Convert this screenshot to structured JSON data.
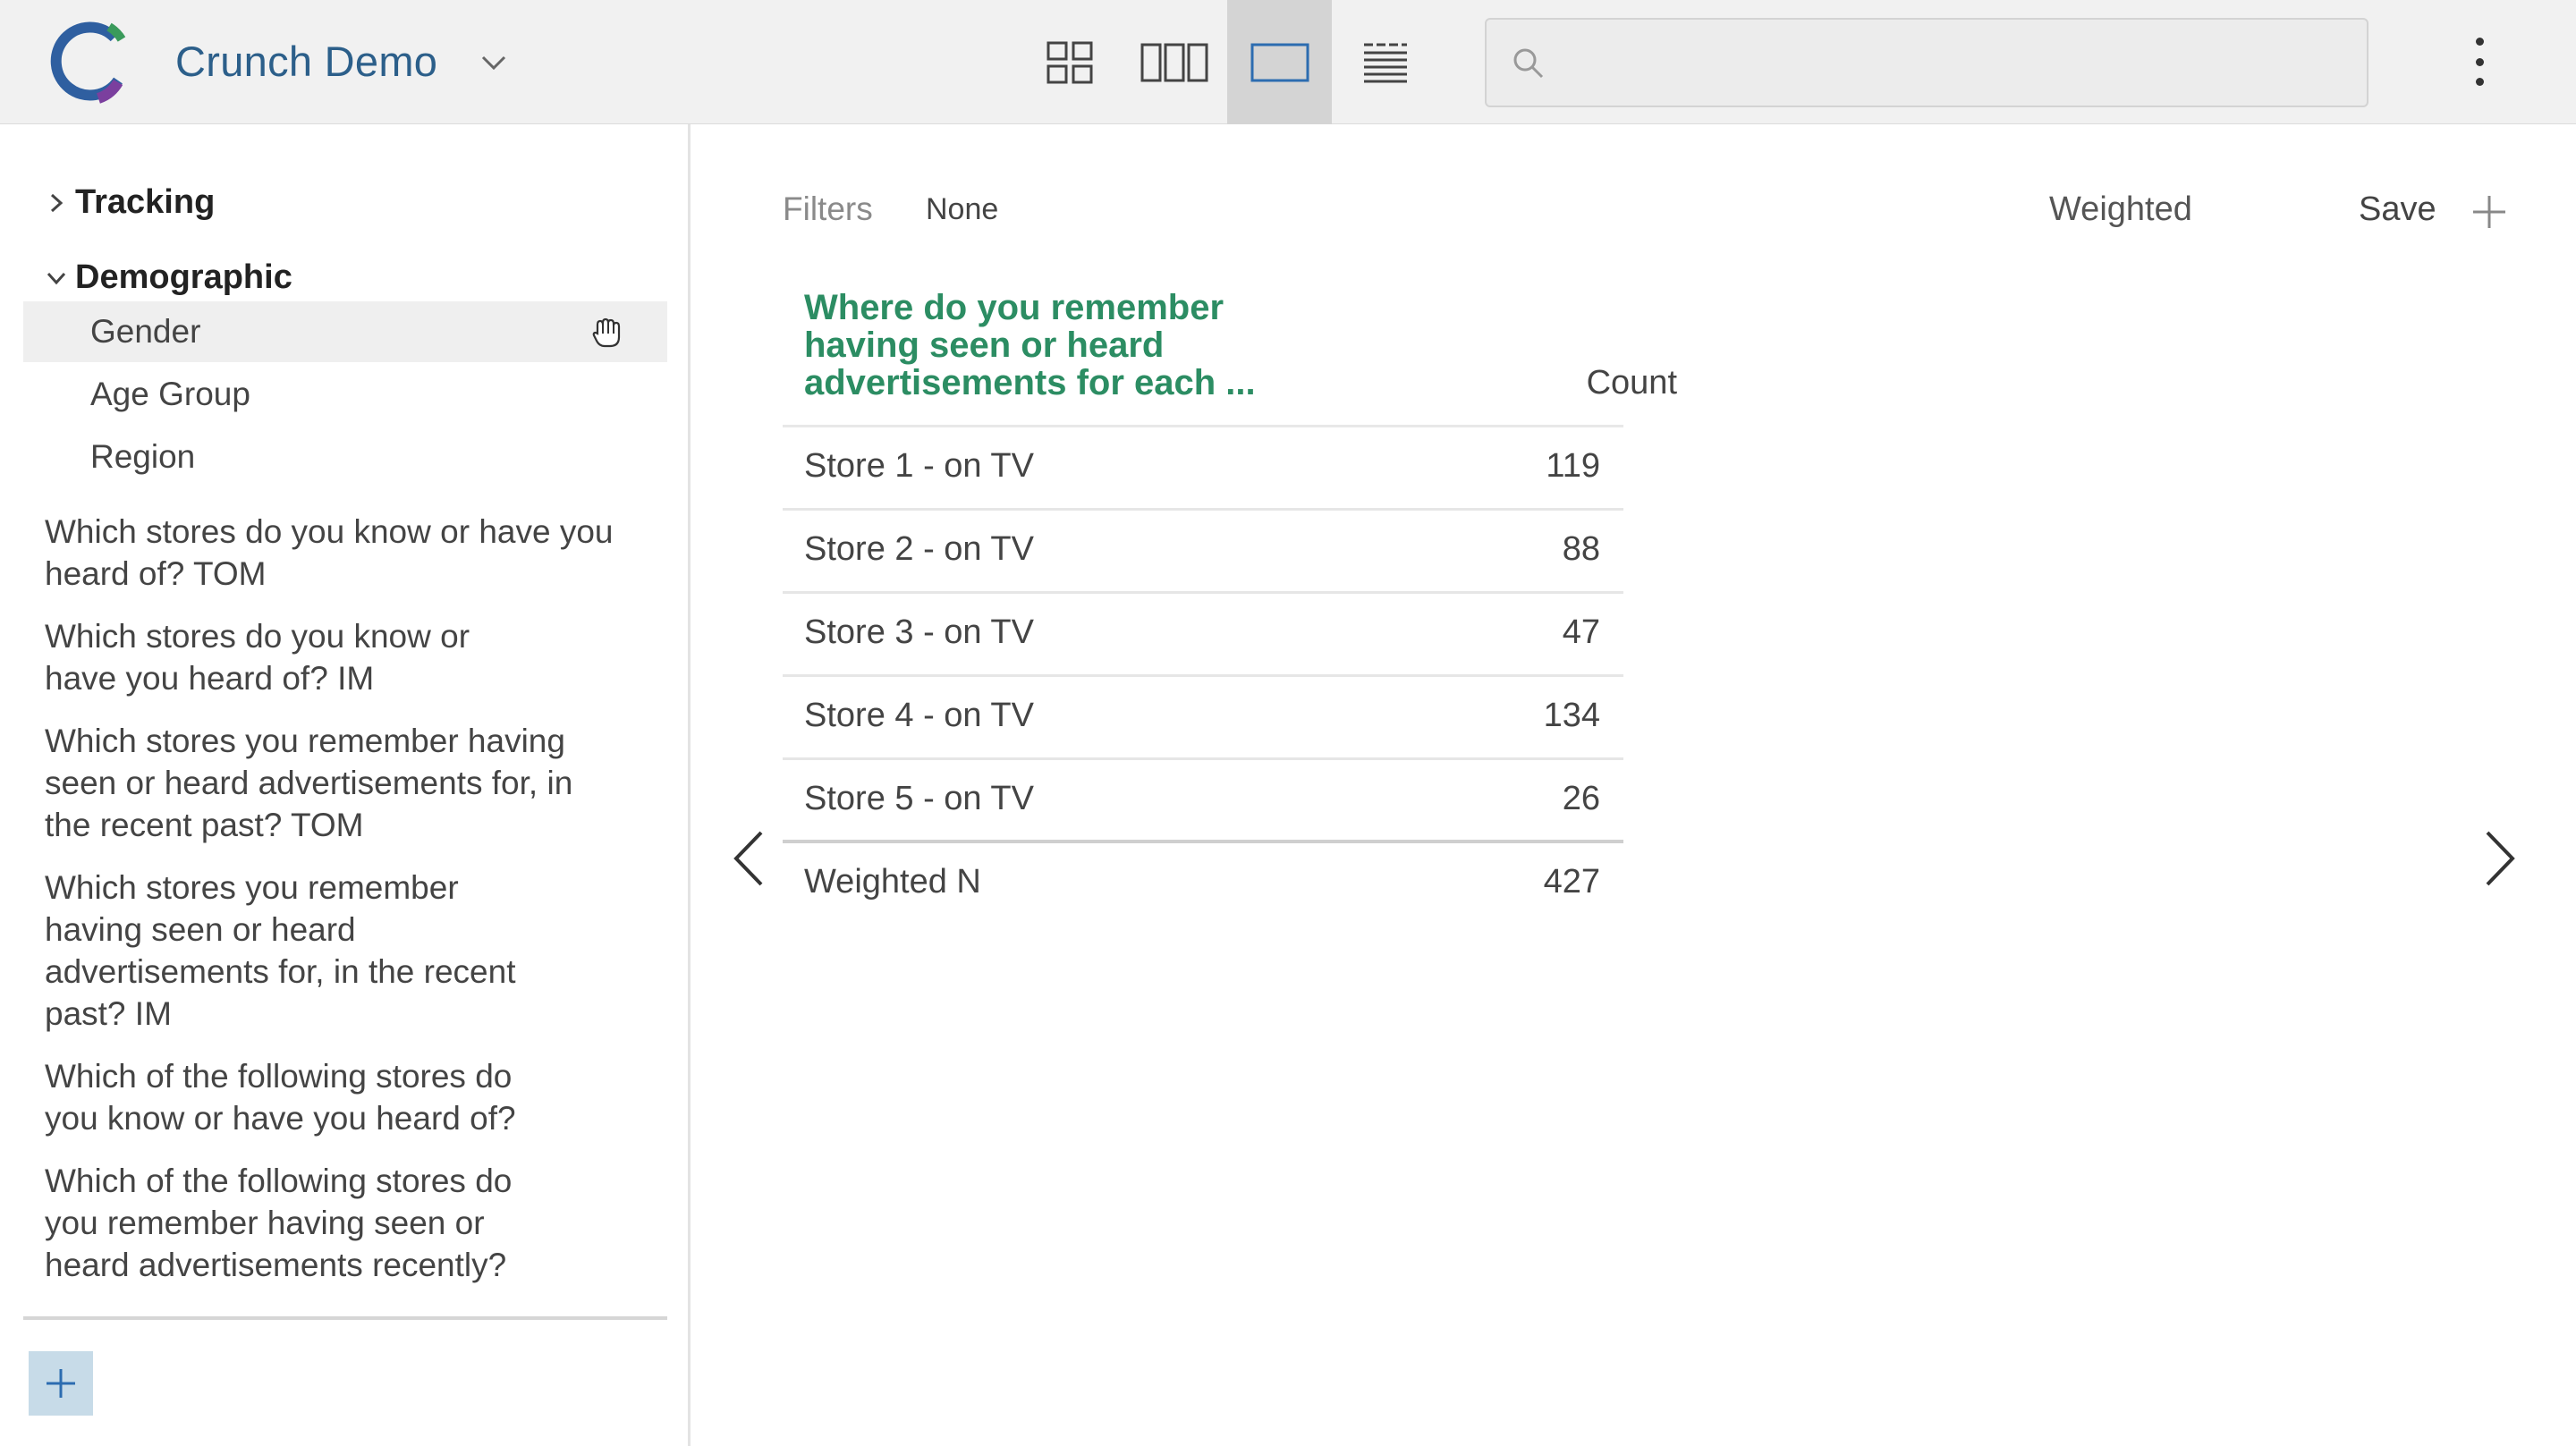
{
  "header": {
    "app_title": "Crunch Demo",
    "search_placeholder": "",
    "views": [
      {
        "name": "grid-view",
        "active": false
      },
      {
        "name": "columns-view",
        "active": false
      },
      {
        "name": "single-view",
        "active": true
      },
      {
        "name": "list-view",
        "active": false
      }
    ]
  },
  "sidebar": {
    "folders": [
      {
        "label": "Tracking",
        "expanded": false
      },
      {
        "label": "Demographic",
        "expanded": true
      }
    ],
    "demographic_items": [
      "Gender",
      "Age Group",
      "Region"
    ],
    "selected_item": "Gender",
    "questions": [
      {
        "lines": [
          "Which stores do you know or have you",
          "heard of? TOM"
        ]
      },
      {
        "lines": [
          "Which stores do you know or",
          "have you heard of? IM"
        ]
      },
      {
        "lines": [
          "Which stores you remember having",
          "seen or heard advertisements for, in",
          "the recent past? TOM"
        ]
      },
      {
        "lines": [
          "Which stores you remember",
          "having seen or heard",
          "advertisements for, in the recent",
          "past? IM"
        ]
      },
      {
        "lines": [
          "Which of the following stores do",
          "you know or have you heard of?"
        ]
      },
      {
        "lines": [
          "Which of the following stores do",
          "you remember having seen or",
          "heard advertisements recently?"
        ]
      }
    ]
  },
  "main": {
    "filters_label": "Filters",
    "filters_value": "None",
    "weighted_label": "Weighted",
    "save_label": "Save",
    "table": {
      "title_lines": [
        "Where do you remember",
        "having seen or heard",
        "advertisements for each ..."
      ],
      "count_header": "Count",
      "rows": [
        {
          "label": "Store 1 - on TV",
          "value": "119"
        },
        {
          "label": "Store 2 - on TV",
          "value": "88"
        },
        {
          "label": "Store 3 - on TV",
          "value": "47"
        },
        {
          "label": "Store 4 - on TV",
          "value": "134"
        },
        {
          "label": "Store 5 - on TV",
          "value": "26"
        }
      ],
      "total": {
        "label": "Weighted N",
        "value": "427"
      }
    }
  },
  "colors": {
    "brand_blue": "#2c5f8a",
    "title_green": "#2c8d63",
    "logo_blue": "#2f5fa0",
    "logo_green": "#3a9a5b",
    "logo_purple": "#7b3f9e"
  }
}
